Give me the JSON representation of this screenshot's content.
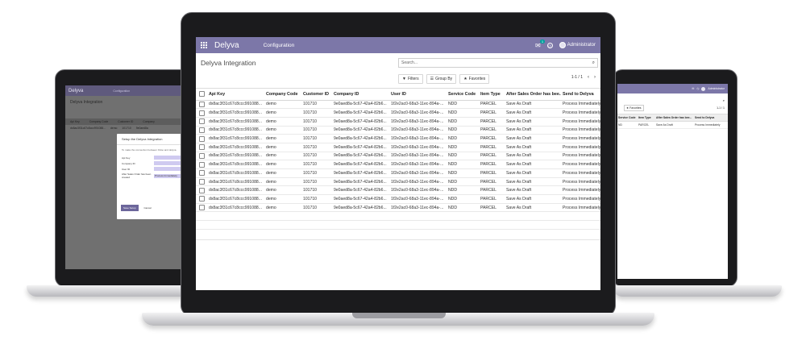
{
  "app": {
    "brand": "Delyva",
    "menu": "Configuration",
    "user": "Administrator",
    "chat_count": "1"
  },
  "page": {
    "title": "Delyva Integration",
    "search_placeholder": "Search...",
    "filters_label": "Filters",
    "groupby_label": "Group By",
    "favorites_label": "Favorites",
    "pager": "1-1 / 1"
  },
  "table": {
    "headers": [
      "Api Key",
      "Company Code",
      "Customer ID",
      "Company ID",
      "User ID",
      "Service Code",
      "Item Type",
      "After Sales Order has bee...",
      "Send to Delyva"
    ],
    "rows": [
      [
        "dx8ac3f31c67c8ccc991088...",
        "demo",
        "101710",
        "9e0aed8a-5c67-42a4-82b6...",
        "1f2e2ac0-68a3-11ec-894a-...",
        "NDD",
        "PARCEL",
        "Save As Draft",
        "Process Immediately"
      ],
      [
        "dx8ac3f31c67c8ccc991088...",
        "demo",
        "101710",
        "9e0aed8a-5c67-42a4-82b6...",
        "1f2e2ac0-68a3-11ec-894a-...",
        "NDD",
        "PARCEL",
        "Save As Draft",
        "Process Immediately"
      ],
      [
        "dx8ac3f31c67c8ccc991088...",
        "demo",
        "101710",
        "9e0aed8a-5c67-42a4-82b6...",
        "1f2e2ac0-68a3-11ec-894a-...",
        "NDD",
        "PARCEL",
        "Save As Draft",
        "Process Immediately"
      ],
      [
        "dx8ac3f31c67c8ccc991088...",
        "demo",
        "101710",
        "9e0aed8a-5c67-42a4-82b6...",
        "1f2e2ac0-68a3-11ec-894a-...",
        "NDD",
        "PARCEL",
        "Save As Draft",
        "Process Immediately"
      ],
      [
        "dx8ac3f31c67c8ccc991088...",
        "demo",
        "101710",
        "9e0aed8a-5c67-42a4-82b6...",
        "1f2e2ac0-68a3-11ec-894a-...",
        "NDD",
        "PARCEL",
        "Save As Draft",
        "Process Immediately"
      ],
      [
        "dx8ac3f31c67c8ccc991088...",
        "demo",
        "101710",
        "9e0aed8a-5c67-42a4-82b6...",
        "1f2e2ac0-68a3-11ec-894a-...",
        "NDD",
        "PARCEL",
        "Save As Draft",
        "Process Immediately"
      ],
      [
        "dx8ac3f31c67c8ccc991088...",
        "demo",
        "101710",
        "9e0aed8a-5c67-42a4-82b6...",
        "1f2e2ac0-68a3-11ec-894a-...",
        "NDD",
        "PARCEL",
        "Save As Draft",
        "Process Immediately"
      ],
      [
        "dx8ac3f31c67c8ccc991088...",
        "demo",
        "101710",
        "9e0aed8a-5c67-42a4-82b6...",
        "1f2e2ac0-68a3-11ec-894a-...",
        "NDD",
        "PARCEL",
        "Save As Draft",
        "Process Immediately"
      ],
      [
        "dx8ac3f31c67c8ccc991088...",
        "demo",
        "101710",
        "9e0aed8a-5c67-42a4-82b6...",
        "1f2e2ac0-68a3-11ec-894a-...",
        "NDD",
        "PARCEL",
        "Save As Draft",
        "Process Immediately"
      ],
      [
        "dx8ac3f31c67c8ccc991088...",
        "demo",
        "101710",
        "9e0aed8a-5c67-42a4-82b6...",
        "1f2e2ac0-68a3-11ec-894a-...",
        "NDD",
        "PARCEL",
        "Save As Draft",
        "Process Immediately"
      ],
      [
        "dx8ac3f31c67c8ccc991088...",
        "demo",
        "101710",
        "9e0aed8a-5c67-42a4-82b6...",
        "1f2e2ac0-68a3-11ec-894a-...",
        "NDD",
        "PARCEL",
        "Save As Draft",
        "Process Immediately"
      ],
      [
        "dx8ac3f31c67c8ccc991088...",
        "demo",
        "101710",
        "9e0aed8a-5c67-42a4-82b6...",
        "1f2e2ac0-68a3-11ec-894a-...",
        "NDD",
        "PARCEL",
        "Save As Draft",
        "Process Immediately"
      ],
      [
        "dx8ac3f31c67c8ccc991088...",
        "demo",
        "101710",
        "9e0aed8a-5c67-42a4-82b6...",
        "1f2e2ac0-68a3-11ec-894a-...",
        "NDD",
        "PARCEL",
        "Save As Draft",
        "Process Immediately"
      ]
    ]
  },
  "left_screen": {
    "brand": "Delyva",
    "menu": "Configuration",
    "title": "Delyva Integration",
    "headers": [
      "Api Key",
      "Company Code",
      "Customer ID",
      "Company"
    ],
    "row": [
      "dx8ac3f31c67c8ccc991088...",
      "demo",
      "101710",
      "9e0aed8a"
    ],
    "dialog": {
      "title": "Setup the Delyva Integration",
      "intro": "To make the connection between Odoo and delyva.",
      "fields": [
        "Api Key",
        "Company ID",
        "User ID",
        "After Sales Order has been created"
      ],
      "process_value": "Process Immediately",
      "save_label": "Save Setup",
      "cancel_label": "Cancel"
    }
  },
  "right_screen": {
    "user": "Administrator",
    "favorites_label": "Favorites",
    "pager": "1-1 / 1",
    "headers": [
      "Service Code",
      "Item Type",
      "After Sales Order has bee...",
      "Send to Delyva"
    ],
    "row": [
      "ND",
      "PARCEL",
      "Save As Draft",
      "Process Immediately"
    ]
  },
  "colors": {
    "navbar": "#7c77a8",
    "laptop_bezel": "#1b1b1d"
  }
}
